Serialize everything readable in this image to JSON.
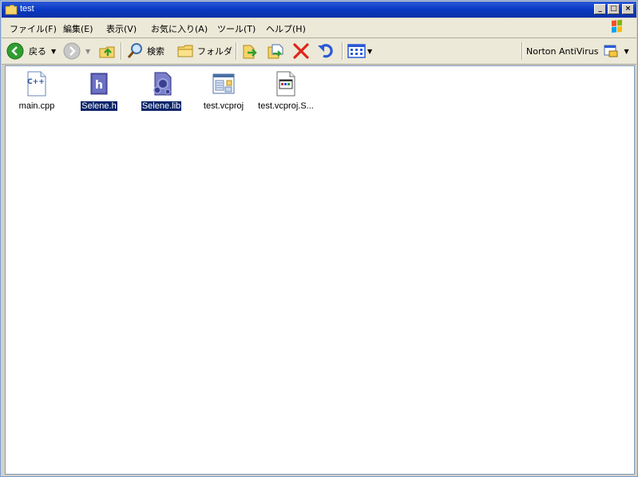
{
  "window": {
    "title": "test"
  },
  "title_buttons": {
    "minimize": "_",
    "maximize": "□",
    "close": "×"
  },
  "menu": [
    "ファイル(F)",
    "編集(E)",
    "表示(V)",
    "お気に入り(A)",
    "ツール(T)",
    "ヘルプ(H)"
  ],
  "toolbar": {
    "back_label": "戻る",
    "search_label": "検索",
    "folders_label": "フォルダ",
    "norton_label": "Norton AntiVirus"
  },
  "files": [
    {
      "name": "main.cpp",
      "icon": "cpp-file-icon",
      "selected": false
    },
    {
      "name": "Selene.h",
      "icon": "h-file-icon",
      "selected": true
    },
    {
      "name": "Selene.lib",
      "icon": "lib-file-icon",
      "selected": true
    },
    {
      "name": "test.vcproj",
      "icon": "vcproj-file-icon",
      "selected": false
    },
    {
      "name": "test.vcproj.S...",
      "icon": "settings-file-icon",
      "selected": false
    }
  ],
  "colors": {
    "titlebar": "#0c3bc4",
    "selection": "#0a246a",
    "toolbar": "#ece9d8"
  }
}
